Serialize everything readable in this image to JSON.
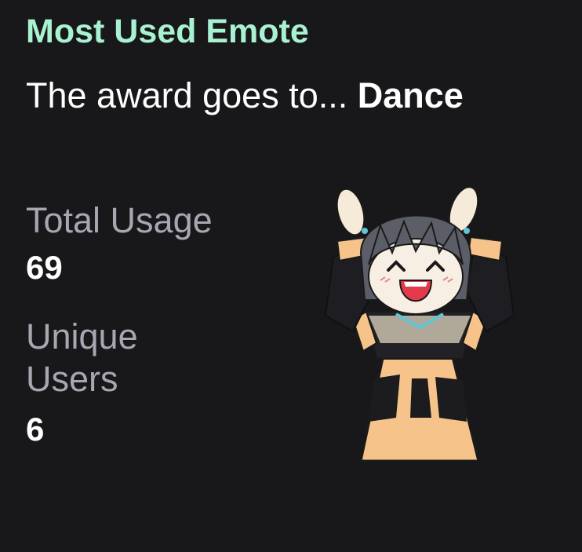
{
  "card": {
    "title": "Most Used Emote",
    "subtitle_prefix": "The award goes to... ",
    "winner": "Dance",
    "stats": [
      {
        "label": "Total Usage",
        "value": "69"
      },
      {
        "label": "Unique Users",
        "value": "6"
      }
    ],
    "emote_icon": "dancing-chibi-emote-icon"
  },
  "colors": {
    "background": "#18181a",
    "title": "#a8f2d2",
    "label": "#a9a6b2",
    "value": "#ffffff"
  }
}
